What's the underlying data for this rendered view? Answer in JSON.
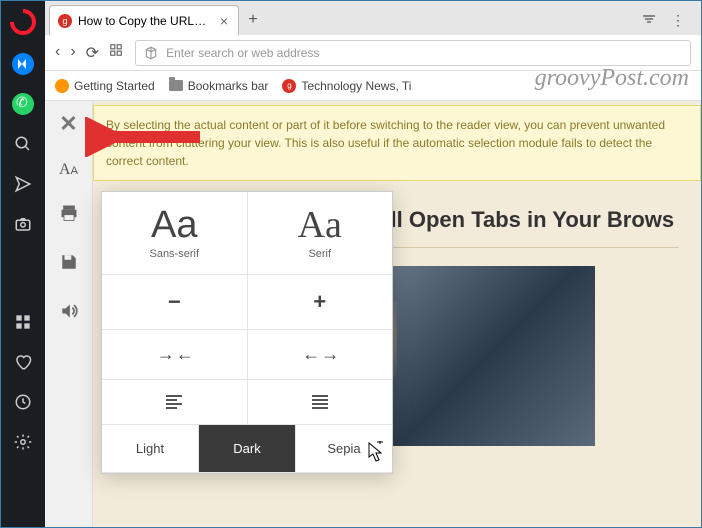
{
  "tab": {
    "title": "How to Copy the URLs Fro"
  },
  "newtab_icon": "+",
  "address": {
    "placeholder": "Enter search or web address"
  },
  "bookmarks": {
    "getting_started": "Getting Started",
    "bar": "Bookmarks bar",
    "technews": "Technology News, Ti"
  },
  "tip_text": "By selecting the actual content or part of it before switching to the reader view, you can prevent unwanted content from cluttering your view. This is also useful if the automatic selection module fails to detect the correct content.",
  "article_title_fragment": "m All Open Tabs in Your Brows",
  "popup": {
    "sans": {
      "sample": "Aa",
      "label": "Sans-serif"
    },
    "serif": {
      "sample": "Aa",
      "label": "Serif"
    },
    "dec": "−",
    "inc": "+",
    "narrow": "→ ←",
    "widen": "← →",
    "align_left": "≡",
    "align_just": "≣",
    "light": "Light",
    "dark": "Dark",
    "sepia": "Sepia"
  },
  "watermark": "groovyPost.com"
}
